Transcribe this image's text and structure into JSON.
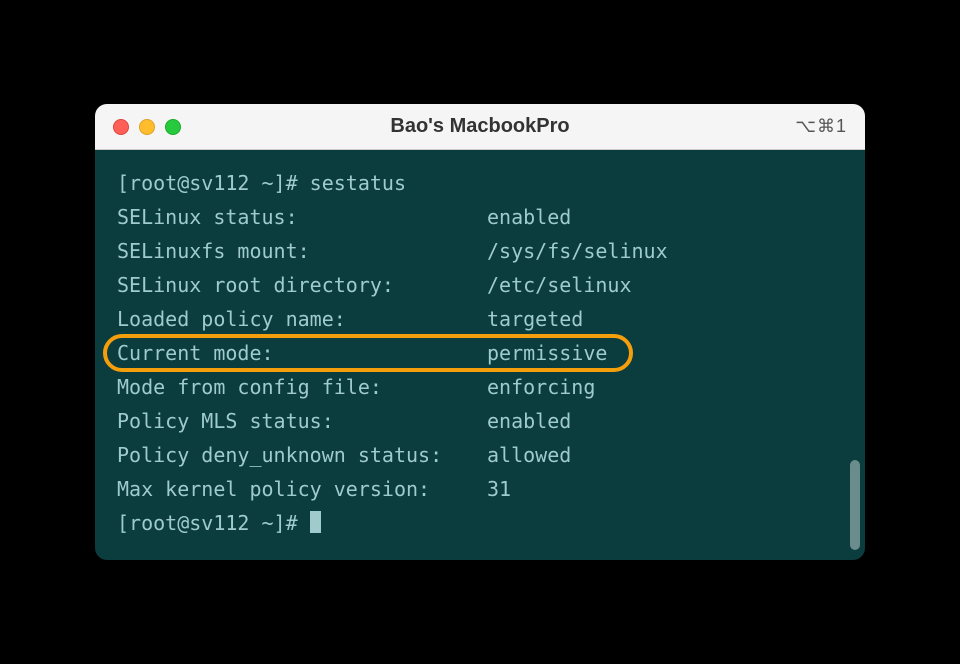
{
  "window": {
    "title": "Bao's MacbookPro",
    "shortcut": "⌥⌘1"
  },
  "terminal": {
    "prompt_line1": "[root@sv112 ~]# sestatus",
    "prompt_line2": "[root@sv112 ~]# ",
    "rows": [
      {
        "label": "SELinux status:",
        "value": "enabled"
      },
      {
        "label": "SELinuxfs mount:",
        "value": "/sys/fs/selinux"
      },
      {
        "label": "SELinux root directory:",
        "value": "/etc/selinux"
      },
      {
        "label": "Loaded policy name:",
        "value": "targeted"
      },
      {
        "label": "Current mode:",
        "value": "permissive"
      },
      {
        "label": "Mode from config file:",
        "value": "enforcing"
      },
      {
        "label": "Policy MLS status:",
        "value": "enabled"
      },
      {
        "label": "Policy deny_unknown status:",
        "value": "allowed"
      },
      {
        "label": "Max kernel policy version:",
        "value": "31"
      }
    ],
    "highlight_index": 4
  }
}
